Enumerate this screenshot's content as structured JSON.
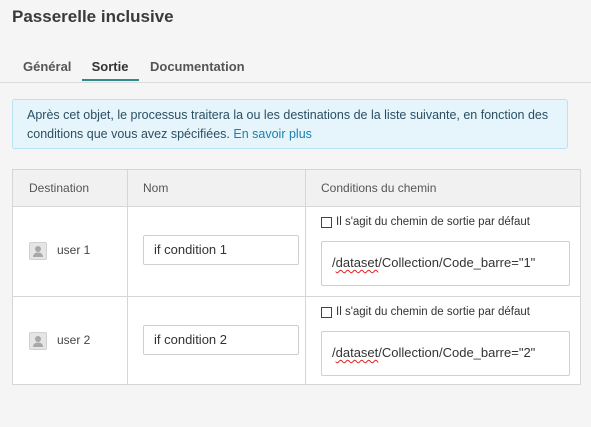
{
  "header": {
    "title": "Passerelle inclusive"
  },
  "tabs": [
    {
      "label": "Général"
    },
    {
      "label": "Sortie"
    },
    {
      "label": "Documentation"
    }
  ],
  "info": {
    "text": "Après cet objet, le processus traitera la ou les destinations de la liste suivante, en fonction des conditions que vous avez spécifiées.",
    "link": "En savoir plus"
  },
  "table": {
    "columns": [
      "Destination",
      "Nom",
      "Conditions du chemin"
    ],
    "default_path_label": "Il s'agit du chemin de sortie par défaut",
    "rows": [
      {
        "destination": "user 1",
        "name": "if condition 1",
        "condition_prefix": "/",
        "condition_flagged": "dataset",
        "condition_rest": "/Collection/Code_barre=\"1\""
      },
      {
        "destination": "user 2",
        "name": "if condition 2",
        "condition_prefix": "/",
        "condition_flagged": "dataset",
        "condition_rest": "/Collection/Code_barre=\"2\""
      }
    ]
  },
  "colors": {
    "accent": "#2f8b8b",
    "info_bg": "#e6f5fc",
    "link": "#1d7fae"
  },
  "icons": [
    "user-icon",
    "checkbox-icon"
  ]
}
